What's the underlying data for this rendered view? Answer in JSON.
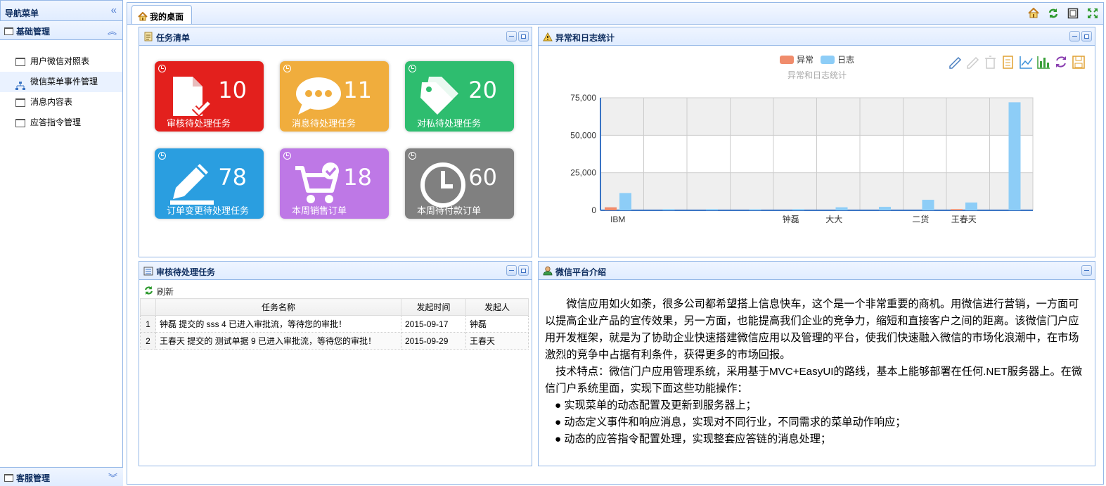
{
  "nav": {
    "title": "导航菜单",
    "groups": [
      {
        "label": "基础管理"
      },
      {
        "label": "客服管理"
      }
    ],
    "items": [
      {
        "label": "用户微信对照表",
        "icon": "window-icon"
      },
      {
        "label": "微信菜单事件管理",
        "icon": "tree-icon"
      },
      {
        "label": "消息内容表",
        "icon": "window-icon"
      },
      {
        "label": "应答指令管理",
        "icon": "window-icon"
      }
    ]
  },
  "tabs": [
    {
      "label": "我的桌面"
    }
  ],
  "tasks_panel": {
    "title": "任务清单",
    "tiles": [
      {
        "count": "10",
        "label": "审核待处理任务",
        "color": "#e3201d"
      },
      {
        "count": "11",
        "label": "消息待处理任务",
        "color": "#f0ad3d"
      },
      {
        "count": "20",
        "label": "对私待处理任务",
        "color": "#2ebd6f"
      },
      {
        "count": "78",
        "label": "订单变更待处理任务",
        "color": "#2a9ee0"
      },
      {
        "count": "18",
        "label": "本周销售订单",
        "color": "#be78e6"
      },
      {
        "count": "60",
        "label": "本周待付款订单",
        "color": "#808080"
      }
    ]
  },
  "stats_panel": {
    "title": "异常和日志统计"
  },
  "chart_data": {
    "type": "bar",
    "title": "异常和日志统计",
    "legend": [
      "异常",
      "日志"
    ],
    "legend_position": "top-center",
    "categories": [
      "IBM",
      "",
      "",
      "",
      "钟磊",
      "大大",
      "",
      "二货",
      "王春天",
      ""
    ],
    "series": [
      {
        "name": "异常",
        "color": "#f08c6c",
        "values": [
          2000,
          0,
          0,
          0,
          0,
          0,
          0,
          0,
          800,
          0
        ]
      },
      {
        "name": "日志",
        "color": "#8dcdf7",
        "values": [
          11500,
          800,
          800,
          600,
          800,
          2000,
          2300,
          7000,
          5200,
          72000
        ]
      }
    ],
    "yticks": [
      "75,000",
      "50,000",
      "25,000",
      "0"
    ],
    "ylim": [
      0,
      75000
    ],
    "grid": true,
    "toolbox": [
      "mark-icon",
      "mark-undo-icon",
      "mark-clear-icon",
      "data-view-icon",
      "line-chart-icon",
      "bar-chart-icon",
      "restore-icon",
      "save-image-icon"
    ]
  },
  "pending_panel": {
    "title": "审核待处理任务",
    "refresh_label": "刷新",
    "columns": [
      "任务名称",
      "发起时间",
      "发起人"
    ],
    "rows": [
      {
        "index": "1",
        "name": "钟磊 提交的 sss 4 已进入审批流，等待您的审批！",
        "time": "2015-09-17",
        "user": "钟磊"
      },
      {
        "index": "2",
        "name": "王春天 提交的 测试单据 9 已进入审批流，等待您的审批！",
        "time": "2015-09-29",
        "user": "王春天"
      }
    ]
  },
  "intro_panel": {
    "title": "微信平台介绍",
    "para1": "微信应用如火如荼，很多公司都希望搭上信息快车，这个是一个非常重要的商机。用微信进行营销，一方面可以提高企业产品的宣传效果，另一方面，也能提高我们企业的竞争力，缩短和直接客户之间的距离。该微信门户应用开发框架，就是为了协助企业快速搭建微信应用以及管理的平台，使我们快速融入微信的市场化浪潮中，在市场激烈的竞争中占据有利条件，获得更多的市场回报。",
    "para2": "技术特点：微信门户应用管理系统，采用基于MVC+EasyUI的路线，基本上能够部署在任何.NET服务器上。在微信门户系统里面，实现下面这些功能操作：",
    "bullets": [
      "实现菜单的动态配置及更新到服务器上；",
      "动态定义事件和响应消息，实现对不同行业，不同需求的菜单动作响应；",
      "动态的应答指令配置处理，实现整套应答链的消息处理；"
    ]
  }
}
